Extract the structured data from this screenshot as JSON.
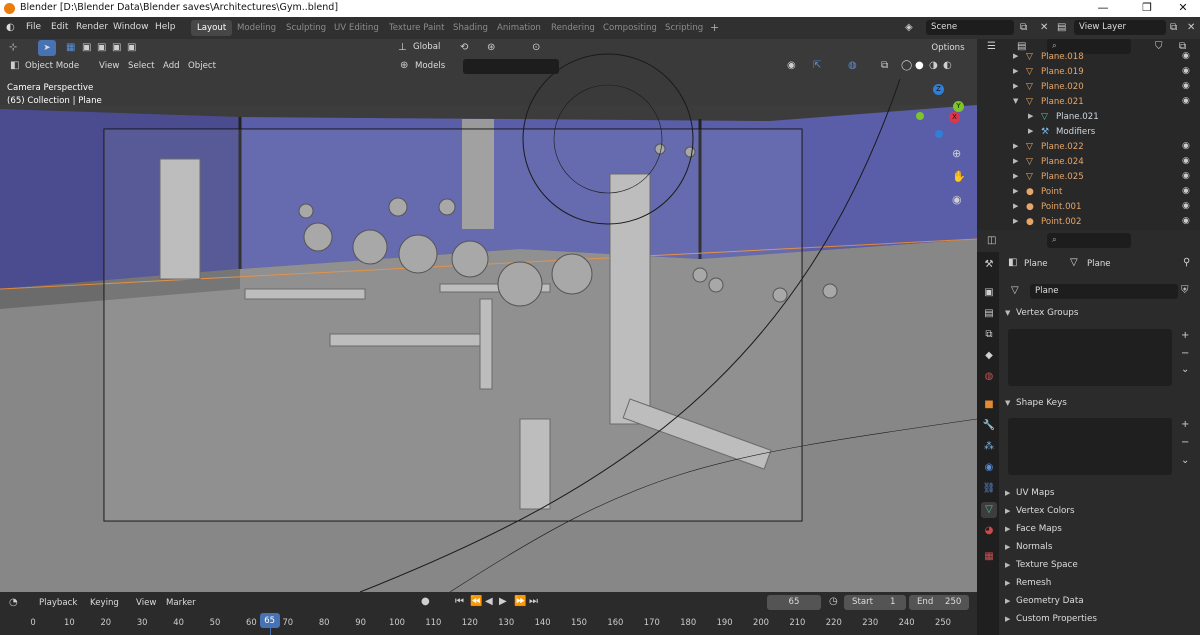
{
  "titlebar": {
    "title": "Blender [D:\\Blender Data\\Blender saves\\Architectures\\Gym..blend]",
    "minimize": "—",
    "maximize": "❐",
    "close": "✕"
  },
  "menu": [
    "File",
    "Edit",
    "Render",
    "Window",
    "Help"
  ],
  "workspaces": [
    "Layout",
    "Modeling",
    "Sculpting",
    "UV Editing",
    "Texture Paint",
    "Shading",
    "Animation",
    "Rendering",
    "Compositing",
    "Scripting"
  ],
  "workspace_add": "+",
  "scene": {
    "label": "Scene"
  },
  "view_layer": {
    "label": "View Layer"
  },
  "viewport": {
    "transform_orientation": "Global",
    "options": "Options",
    "mode": "Object Mode",
    "menus": [
      "View",
      "Select",
      "Add",
      "Object"
    ],
    "collection_filter": "Models",
    "search_placeholder": "",
    "overlay_line1": "Camera Perspective",
    "overlay_line2": "(65) Collection | Plane",
    "axes": {
      "z": "Z",
      "y": "Y",
      "x": "X"
    }
  },
  "timeline": {
    "menus": [
      "Playback",
      "Keying",
      "View",
      "Marker"
    ],
    "current_frame": "65",
    "start_label": "Start",
    "start": "1",
    "end_label": "End",
    "end": "250",
    "ticks": [
      "0",
      "10",
      "20",
      "30",
      "40",
      "50",
      "60",
      "65",
      "70",
      "80",
      "90",
      "100",
      "110",
      "120",
      "130",
      "140",
      "150",
      "160",
      "170",
      "180",
      "190",
      "200",
      "210",
      "220",
      "230",
      "240",
      "250"
    ]
  },
  "outliner": {
    "items": [
      {
        "label": "Plane.018",
        "indent": 0
      },
      {
        "label": "Plane.019",
        "indent": 0
      },
      {
        "label": "Plane.020",
        "indent": 0
      },
      {
        "label": "Plane.021",
        "indent": 0,
        "expanded": true
      },
      {
        "label": "Plane.021",
        "indent": 1
      },
      {
        "label": "Modifiers",
        "indent": 1
      },
      {
        "label": "Plane.022",
        "indent": 0
      },
      {
        "label": "Plane.024",
        "indent": 0
      },
      {
        "label": "Plane.025",
        "indent": 0
      },
      {
        "label": "Point",
        "indent": 0
      },
      {
        "label": "Point.001",
        "indent": 0
      },
      {
        "label": "Point.002",
        "indent": 0
      }
    ]
  },
  "properties": {
    "object_name": "Plane",
    "data_name": "Plane",
    "mesh_field": "Plane",
    "sections": [
      "Vertex Groups",
      "Shape Keys",
      "UV Maps",
      "Vertex Colors",
      "Face Maps",
      "Normals",
      "Texture Space",
      "Remesh",
      "Geometry Data",
      "Custom Properties"
    ]
  },
  "colors": {
    "accent": "#4772b3",
    "wall": "#5a5ea8",
    "floor": "#8b8b8b",
    "outliner_text": "#e6a66a",
    "mesh_green": "#4ec48b"
  }
}
